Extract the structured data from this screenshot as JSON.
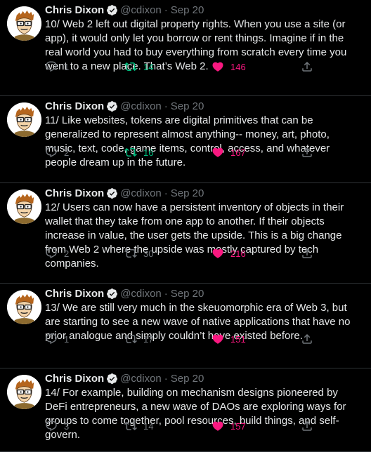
{
  "colors": {
    "background": "#000000",
    "text": "#e7e9ea",
    "muted": "#71767b",
    "retweet_active": "#00ba7c",
    "like_active": "#f91880",
    "verified": "#e7e9ea"
  },
  "tweets": [
    {
      "name": "Chris Dixon",
      "handle": "@cdixon",
      "date": "Sep 20",
      "text": "10/ Web 2 left out digital property rights. When you use a site (or app), it would only let you borrow or rent things. Imagine if in the real world you had to buy everything from scratch every time you went to a new place. That’s Web 2.",
      "replies": "1",
      "retweets": "14",
      "likes": "146",
      "retweeted": true
    },
    {
      "name": "Chris Dixon",
      "handle": "@cdixon",
      "date": "Sep 20",
      "text": "11/ Like websites, tokens are digital primitives that can be generalized to represent almost anything-- money, art, photo, music, text, code, game items, control, access, and whatever people dream up in the future.",
      "replies": "2",
      "retweets": "16",
      "likes": "167",
      "retweeted": true
    },
    {
      "name": "Chris Dixon",
      "handle": "@cdixon",
      "date": "Sep 20",
      "text": "12/ Users can now have a persistent inventory of objects in their wallet that they take from one app to another. If their objects increase in value, the user gets the upside. This is a big change from Web 2 where the upside was mostly captured by tech companies.",
      "replies": "2",
      "retweets": "30",
      "likes": "216",
      "retweeted": false
    },
    {
      "name": "Chris Dixon",
      "handle": "@cdixon",
      "date": "Sep 20",
      "text": "13/ We are still very much in the skeuomorphic era of Web 3, but are starting to see a new wave of native applications that have no prior analogue and simply couldn’t have existed before.",
      "replies": "1",
      "retweets": "17",
      "likes": "151",
      "retweeted": false
    },
    {
      "name": "Chris Dixon",
      "handle": "@cdixon",
      "date": "Sep 20",
      "text": "14/ For example, building on mechanism designs pioneered by DeFi entrepreneurs, a new wave of DAOs are exploring ways for groups to come together, pool resources, build things, and self-govern.",
      "replies": "3",
      "retweets": "14",
      "likes": "157",
      "retweeted": false
    }
  ]
}
